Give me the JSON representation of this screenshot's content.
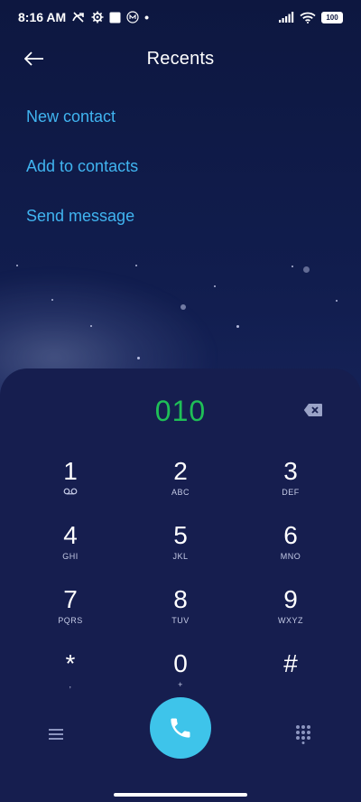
{
  "status_bar": {
    "time": "8:16 AM",
    "battery": "100",
    "dot": "•"
  },
  "header": {
    "title": "Recents"
  },
  "actions": [
    {
      "label": "New contact"
    },
    {
      "label": "Add to contacts"
    },
    {
      "label": "Send message"
    }
  ],
  "dialer": {
    "number": "010",
    "number_color": "#1fbf57",
    "keys": [
      {
        "digit": "1",
        "letters": ""
      },
      {
        "digit": "2",
        "letters": "ABC"
      },
      {
        "digit": "3",
        "letters": "DEF"
      },
      {
        "digit": "4",
        "letters": "GHI"
      },
      {
        "digit": "5",
        "letters": "JKL"
      },
      {
        "digit": "6",
        "letters": "MNO"
      },
      {
        "digit": "7",
        "letters": "PQRS"
      },
      {
        "digit": "8",
        "letters": "TUV"
      },
      {
        "digit": "9",
        "letters": "WXYZ"
      },
      {
        "digit": "*",
        "letters": ","
      },
      {
        "digit": "0",
        "letters": "+"
      },
      {
        "digit": "#",
        "letters": ""
      }
    ]
  },
  "colors": {
    "accent": "#40b4f0",
    "call_button": "#3ec4ea",
    "panel": "#161e4f"
  },
  "icons": {
    "back": "arrow-left-icon",
    "backspace": "backspace-icon",
    "voicemail": "voicemail-icon",
    "menu": "menu-icon",
    "call": "phone-icon",
    "keypad": "dialpad-icon"
  }
}
